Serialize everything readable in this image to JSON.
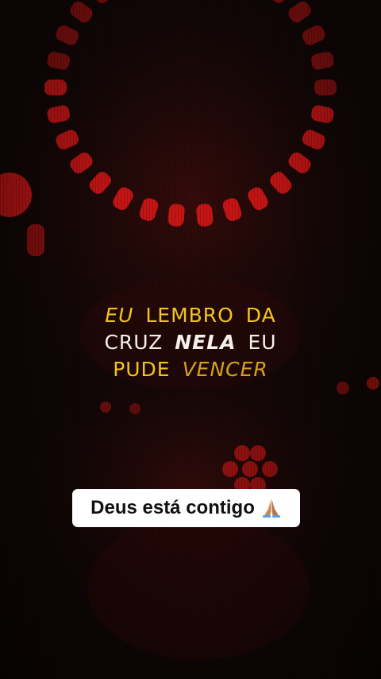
{
  "background": {
    "accent": "#e01818",
    "base": "#0a0505"
  },
  "lyrics": {
    "line1": [
      "EU",
      "LEMBRO",
      "DA"
    ],
    "line2": [
      "CRUZ",
      "NELA",
      "EU"
    ],
    "line3": [
      "PUDE",
      "VENCER"
    ]
  },
  "caption": {
    "text": "Deus está contigo",
    "icon": "praying-hands-icon"
  }
}
